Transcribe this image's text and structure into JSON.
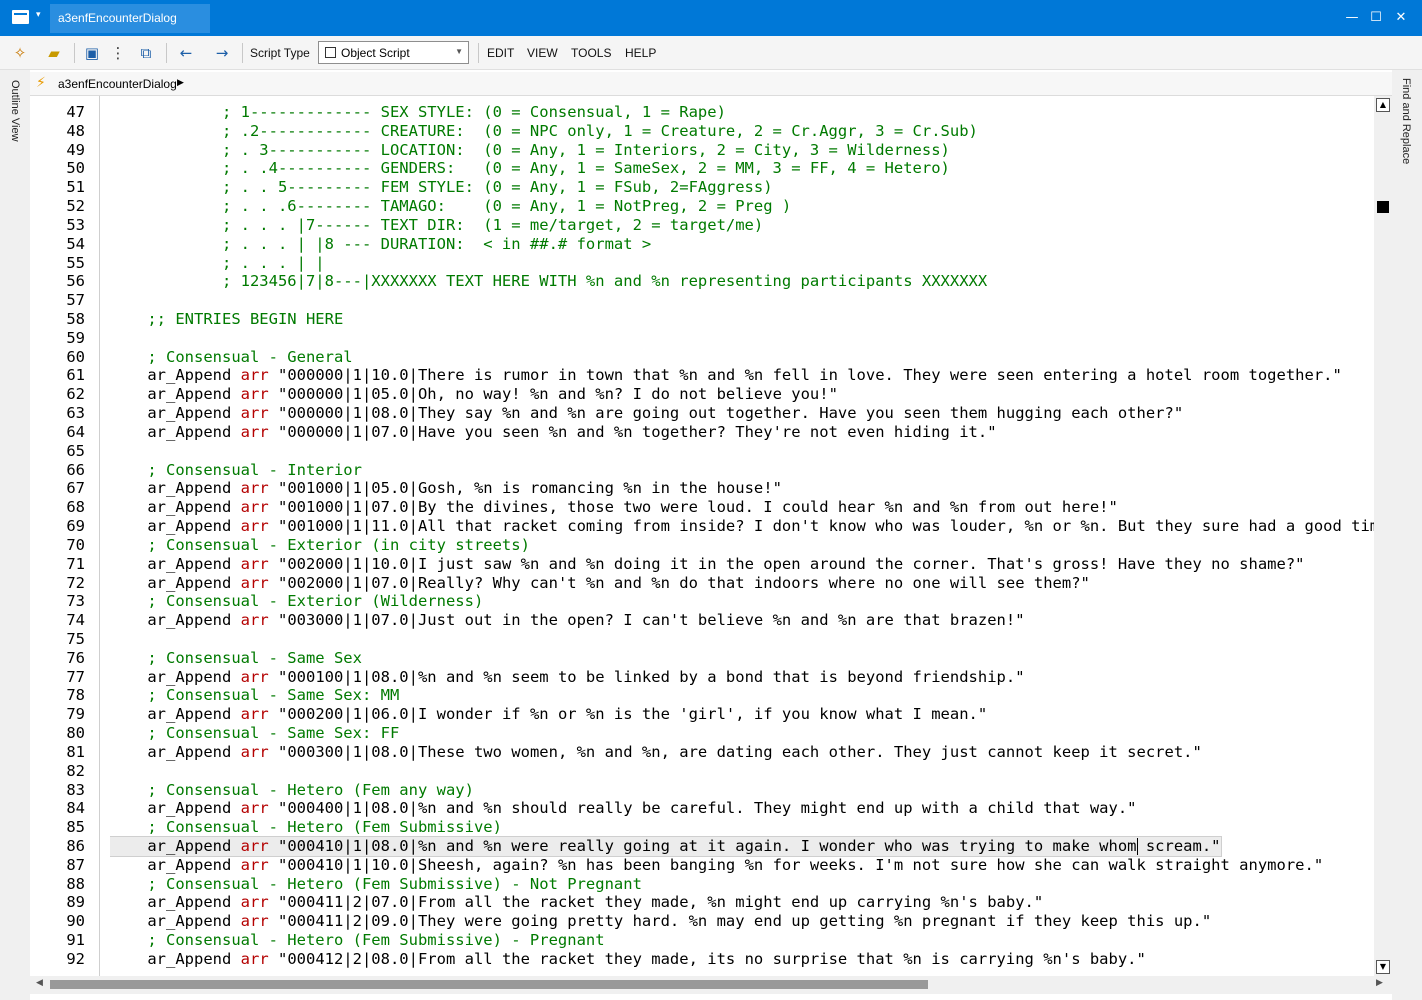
{
  "window": {
    "tab_title": "a3enfEncounterDialog",
    "controls": {
      "dropdown": "▾",
      "minimize": "—",
      "maximize": "☐",
      "close": "✕"
    }
  },
  "toolbar": {
    "icons": {
      "new": "new-script-icon",
      "open": "open-folder-icon",
      "save": "save-icon",
      "more": "more-icon",
      "save_all": "save-all-icon",
      "back": "back-arrow-icon",
      "forward": "forward-arrow-icon"
    },
    "script_type_label": "Script Type",
    "script_type_value": "Object Script",
    "menu": [
      "EDIT",
      "VIEW",
      "TOOLS",
      "HELP"
    ]
  },
  "side_panels": {
    "left": "Outline View",
    "right": "Find and Replace"
  },
  "breadcrumb": {
    "item": "a3enfEncounterDialog"
  },
  "editor": {
    "line_numbers": [
      "47",
      "48",
      "49",
      "50",
      "51",
      "52",
      "53",
      "54",
      "55",
      "56",
      "57",
      "58",
      "59",
      "60",
      "61",
      "62",
      "63",
      "64",
      "65",
      "66",
      "67",
      "68",
      "69",
      "70",
      "71",
      "72",
      "73",
      "74",
      "75",
      "76",
      "77",
      "78",
      "79",
      "80",
      "81",
      "82",
      "83",
      "84",
      "85",
      "86",
      "87",
      "88",
      "89",
      "90",
      "91",
      "92"
    ],
    "highlighted_line": "86",
    "lines": [
      {
        "t": "c",
        "text": "            ; 1------------- SEX STYLE: (0 = Consensual, 1 = Rape)"
      },
      {
        "t": "c",
        "text": "            ; .2------------ CREATURE:  (0 = NPC only, 1 = Creature, 2 = Cr.Aggr, 3 = Cr.Sub)"
      },
      {
        "t": "c",
        "text": "            ; . 3----------- LOCATION:  (0 = Any, 1 = Interiors, 2 = City, 3 = Wilderness)"
      },
      {
        "t": "c",
        "text": "            ; . .4---------- GENDERS:   (0 = Any, 1 = SameSex, 2 = MM, 3 = FF, 4 = Hetero)"
      },
      {
        "t": "c",
        "text": "            ; . . 5--------- FEM STYLE: (0 = Any, 1 = FSub, 2=FAggress)"
      },
      {
        "t": "c",
        "text": "            ; . . .6-------- TAMAGO:    (0 = Any, 1 = NotPreg, 2 = Preg )"
      },
      {
        "t": "c",
        "text": "            ; . . . |7------ TEXT DIR:  (1 = me/target, 2 = target/me)"
      },
      {
        "t": "c",
        "text": "            ; . . . | |8 --- DURATION:  < in ##.# format >"
      },
      {
        "t": "c",
        "text": "            ; . . . | |"
      },
      {
        "t": "c",
        "text": "            ; 123456|7|8---|XXXXXXX TEXT HERE WITH %n and %n representing participants XXXXXXX"
      },
      {
        "t": "e",
        "text": ""
      },
      {
        "t": "c",
        "text": "    ;; ENTRIES BEGIN HERE"
      },
      {
        "t": "e",
        "text": ""
      },
      {
        "t": "c",
        "text": "    ; Consensual - General"
      },
      {
        "t": "a",
        "text": "\"000000|1|10.0|There is rumor in town that %n and %n fell in love. They were seen entering a hotel room together.\""
      },
      {
        "t": "a",
        "text": "\"000000|1|05.0|Oh, no way! %n and %n? I do not believe you!\""
      },
      {
        "t": "a",
        "text": "\"000000|1|08.0|They say %n and %n are going out together. Have you seen them hugging each other?\""
      },
      {
        "t": "a",
        "text": "\"000000|1|07.0|Have you seen %n and %n together? They're not even hiding it.\""
      },
      {
        "t": "e",
        "text": ""
      },
      {
        "t": "c",
        "text": "    ; Consensual - Interior"
      },
      {
        "t": "a",
        "text": "\"001000|1|05.0|Gosh, %n is romancing %n in the house!\""
      },
      {
        "t": "a",
        "text": "\"001000|1|07.0|By the divines, those two were loud. I could hear %n and %n from out here!\""
      },
      {
        "t": "a",
        "text": "\"001000|1|11.0|All that racket coming from inside? I don't know who was louder, %n or %n. But they sure had a good time.\""
      },
      {
        "t": "c",
        "text": "    ; Consensual - Exterior (in city streets)"
      },
      {
        "t": "a",
        "text": "\"002000|1|10.0|I just saw %n and %n doing it in the open around the corner. That's gross! Have they no shame?\""
      },
      {
        "t": "a",
        "text": "\"002000|1|07.0|Really? Why can't %n and %n do that indoors where no one will see them?\""
      },
      {
        "t": "c",
        "text": "    ; Consensual - Exterior (Wilderness)"
      },
      {
        "t": "a",
        "text": "\"003000|1|07.0|Just out in the open? I can't believe %n and %n are that brazen!\""
      },
      {
        "t": "e",
        "text": ""
      },
      {
        "t": "c",
        "text": "    ; Consensual - Same Sex"
      },
      {
        "t": "a",
        "text": "\"000100|1|08.0|%n and %n seem to be linked by a bond that is beyond friendship.\""
      },
      {
        "t": "c",
        "text": "    ; Consensual - Same Sex: MM"
      },
      {
        "t": "a",
        "text": "\"000200|1|06.0|I wonder if %n or %n is the 'girl', if you know what I mean.\""
      },
      {
        "t": "c",
        "text": "    ; Consensual - Same Sex: FF"
      },
      {
        "t": "a",
        "text": "\"000300|1|08.0|These two women, %n and %n, are dating each other. They just cannot keep it secret.\""
      },
      {
        "t": "e",
        "text": ""
      },
      {
        "t": "c",
        "text": "    ; Consensual - Hetero (Fem any way)"
      },
      {
        "t": "a",
        "text": "\"000400|1|08.0|%n and %n should really be careful. They might end up with a child that way.\""
      },
      {
        "t": "c",
        "text": "    ; Consensual - Hetero (Fem Submissive)"
      },
      {
        "t": "a",
        "text": "\"000410|1|08.0|%n and %n were really going at it again. I wonder who was trying to make whom scream.\""
      },
      {
        "t": "a",
        "text": "\"000410|1|10.0|Sheesh, again? %n has been banging %n for weeks. I'm not sure how she can walk straight anymore.\""
      },
      {
        "t": "c",
        "text": "    ; Consensual - Hetero (Fem Submissive) - Not Pregnant"
      },
      {
        "t": "a",
        "text": "\"000411|2|07.0|From all the racket they made, %n might end up carrying %n's baby.\""
      },
      {
        "t": "a",
        "text": "\"000411|2|09.0|They were going pretty hard. %n may end up getting %n pregnant if they keep this up.\""
      },
      {
        "t": "c",
        "text": "    ; Consensual - Hetero (Fem Submissive) - Pregnant"
      },
      {
        "t": "a",
        "text": "\"000412|2|08.0|From all the racket they made, its no surprise that %n is carrying %n's baby.\""
      }
    ],
    "func_name": "ar_Append",
    "arg_name": "arr"
  }
}
